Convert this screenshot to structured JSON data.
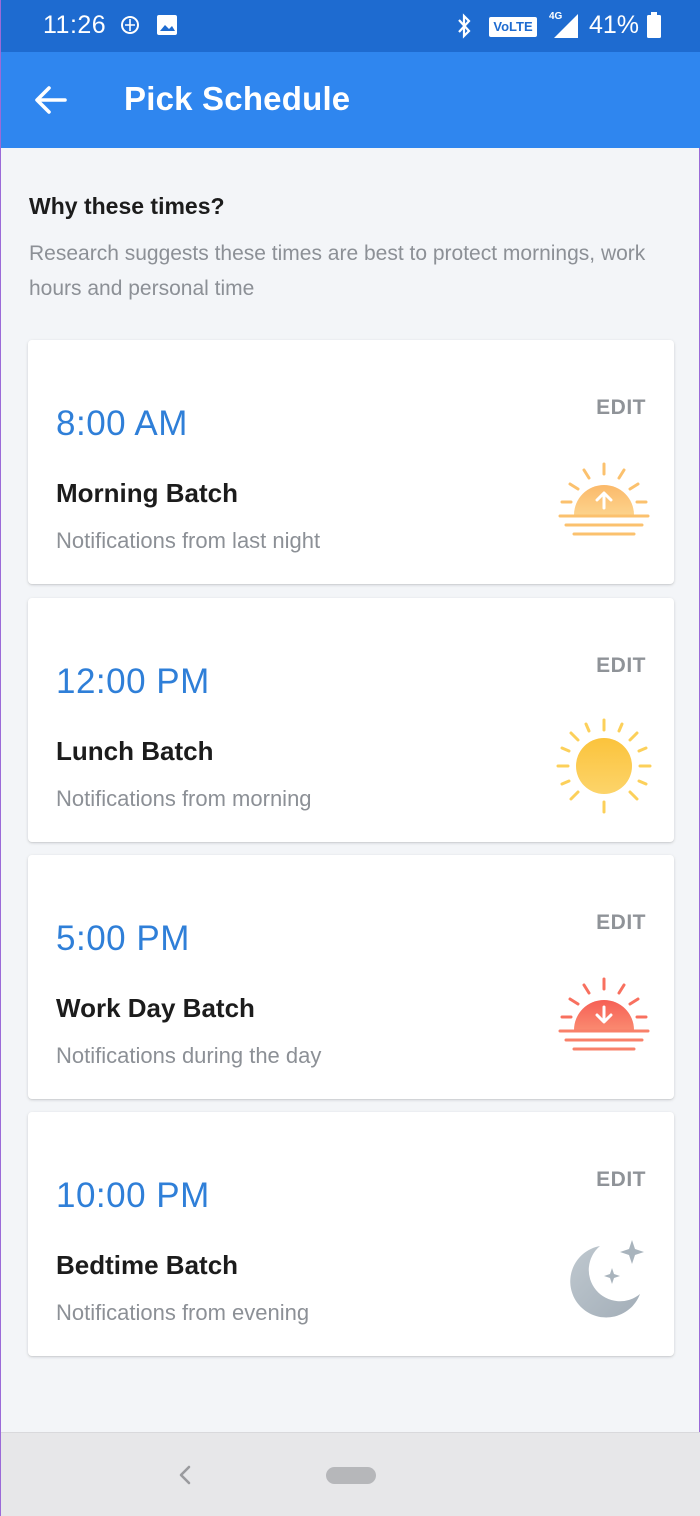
{
  "status_bar": {
    "time": "11:26",
    "network_badge": "VoLTE",
    "signal_label": "4G",
    "battery": "41%",
    "icons": [
      "vpn-icon",
      "image-notification-icon",
      "bluetooth-icon",
      "signal-icon",
      "battery-icon"
    ]
  },
  "app_bar": {
    "title": "Pick Schedule",
    "back_icon": "arrow-left-icon"
  },
  "intro": {
    "heading": "Why these times?",
    "text": "Research suggests these times are best to protect mornings, work hours and personal time"
  },
  "schedules": [
    {
      "time": "8:00 AM",
      "title": "Morning Batch",
      "subtitle": "Notifications from last night",
      "edit": "EDIT",
      "icon": "sunrise-icon"
    },
    {
      "time": "12:00 PM",
      "title": "Lunch Batch",
      "subtitle": "Notifications from morning",
      "edit": "EDIT",
      "icon": "sun-icon"
    },
    {
      "time": "5:00 PM",
      "title": "Work Day Batch",
      "subtitle": "Notifications during the day",
      "edit": "EDIT",
      "icon": "sunset-icon"
    },
    {
      "time": "10:00 PM",
      "title": "Bedtime Batch",
      "subtitle": "Notifications from evening",
      "edit": "EDIT",
      "icon": "moon-icon"
    }
  ],
  "colors": {
    "status_bar": "#1e6bd0",
    "app_bar": "#2f86ef",
    "time_text": "#2f7fd8",
    "background": "#f3f5f8",
    "sunrise": "#fbb96a",
    "sun": "#fbc33c",
    "sunset": "#f8705f",
    "moon": "#a9b4bd"
  },
  "nav_bar": {
    "icons": [
      "nav-back-icon",
      "home-pill-icon"
    ]
  }
}
